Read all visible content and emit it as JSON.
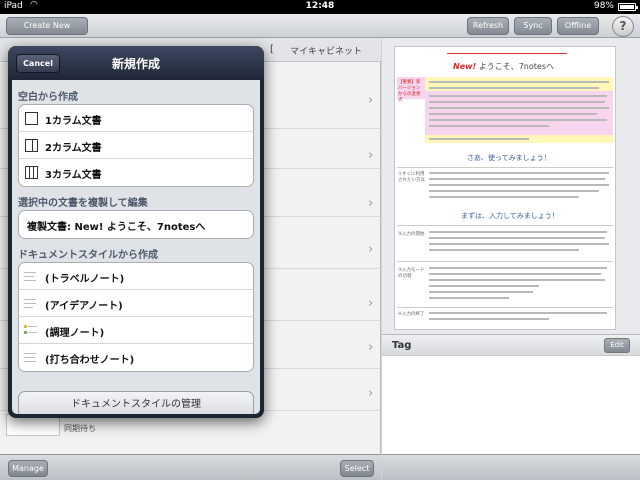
{
  "status_bar": {
    "carrier": "iPad",
    "time": "12:48",
    "battery": "98%"
  },
  "toolbar": {
    "create_new": "Create New",
    "refresh": "Refresh",
    "sync": "Sync",
    "offline": "Offline",
    "help": "?"
  },
  "list_pane": {
    "bracket": "[",
    "cabinet_title": "マイキャビネット",
    "sync_status": "同期待ち",
    "manage": "Manage",
    "select": "Select"
  },
  "popover": {
    "title": "新規作成",
    "cancel": "Cancel",
    "sections": [
      {
        "title": "空白から作成",
        "items": [
          "1カラム文書",
          "2カラム文書",
          "3カラム文書"
        ]
      },
      {
        "title": "選択中の文書を複製して編集",
        "items": [
          "複製文書: New! ようこそ、7notesへ"
        ]
      },
      {
        "title": "ドキュメントスタイルから作成",
        "items": [
          "(トラベルノート)",
          "(アイデアノート)",
          "(調理ノート)",
          "(打ち合わせノート)"
        ]
      }
    ],
    "manage_styles": "ドキュメントスタイルの管理"
  },
  "preview": {
    "title_new": "New!",
    "title_rest": " ようこそ、7notesへ",
    "section1": "さあ、使ってみましょう！",
    "section2": "まずは、入力してみましょう！",
    "label_new_version": "【重要】新バージョンからの変更点",
    "label_step1": "①すぐに利用されたい方は",
    "label_step2": "②入力の開始",
    "label_step3": "③入力モードの切替",
    "label_step4": "④入力の終了"
  },
  "tag_panel": {
    "title": "Tag",
    "edit": "Edit"
  },
  "colors": {
    "popover_dark": "#1d2433",
    "new_red": "#e0282e",
    "highlight_pink": "#f7d5ee",
    "highlight_yellow": "#fff6b8",
    "section_blue": "#3b5e9d"
  }
}
